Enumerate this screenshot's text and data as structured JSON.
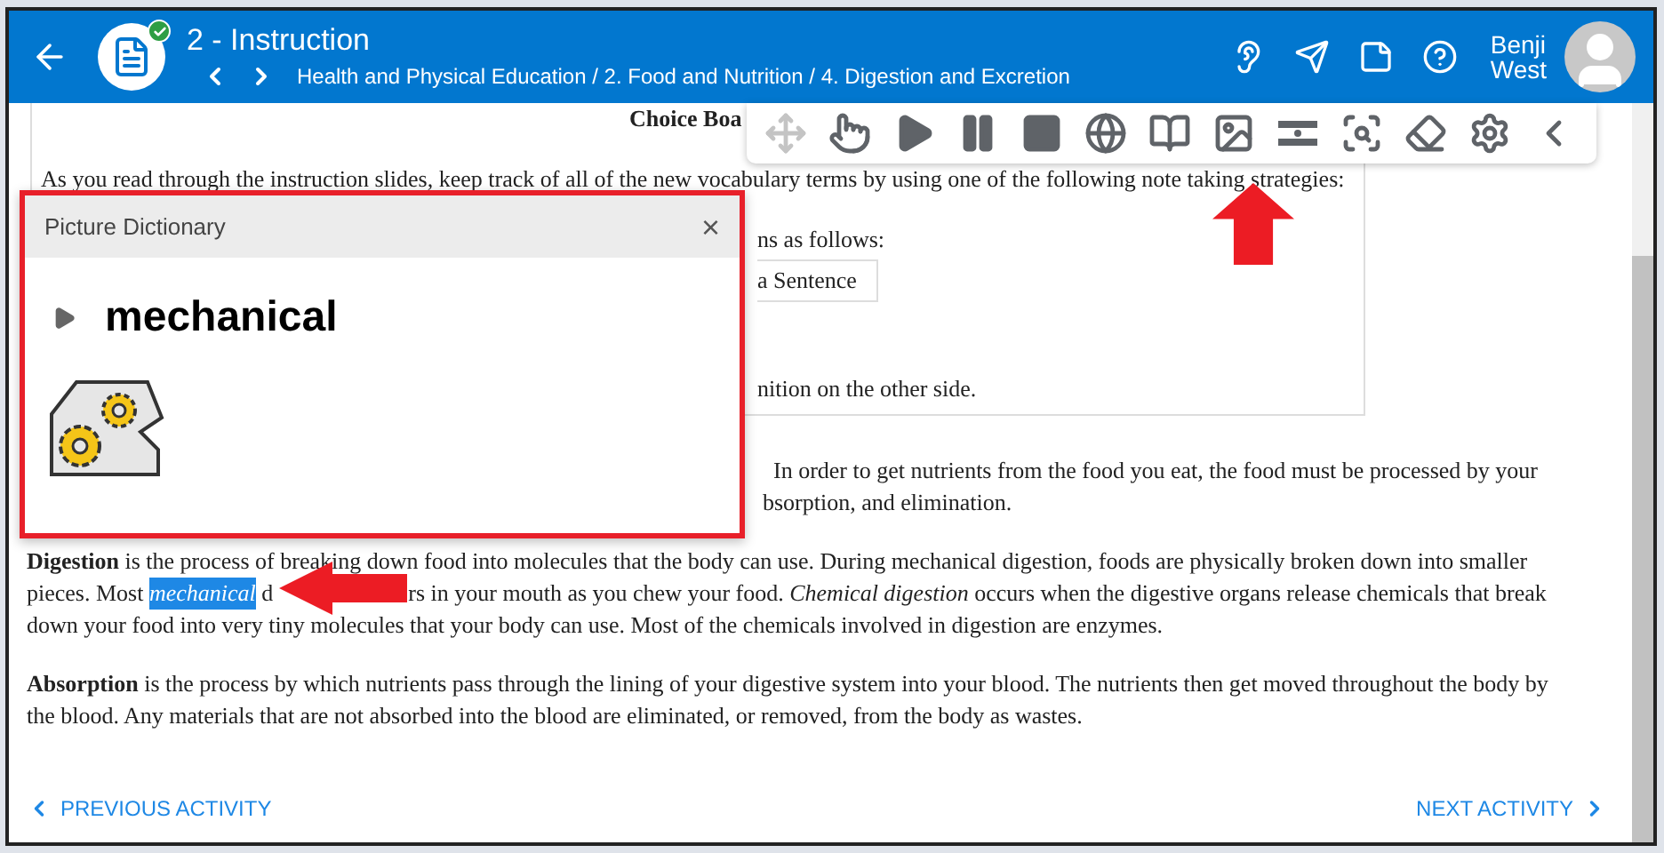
{
  "header": {
    "title": "2 - Instruction",
    "completed": true,
    "breadcrumb": "Health and Physical Education / 2. Food and Nutrition / 4. Digestion and Excretion",
    "user_first": "Benji",
    "user_last": "West"
  },
  "toolbar": {
    "tools": [
      {
        "kind": "move",
        "disabled": true
      },
      {
        "kind": "pointer",
        "disabled": false
      },
      {
        "kind": "play",
        "disabled": false
      },
      {
        "kind": "pause",
        "disabled": false
      },
      {
        "kind": "stop",
        "disabled": false
      },
      {
        "kind": "globe",
        "disabled": false
      },
      {
        "kind": "book",
        "disabled": false
      },
      {
        "kind": "picture",
        "disabled": false
      },
      {
        "kind": "mask",
        "disabled": false
      },
      {
        "kind": "magnifier",
        "disabled": false
      },
      {
        "kind": "eraser",
        "disabled": false
      },
      {
        "kind": "settings",
        "disabled": false
      },
      {
        "kind": "collapse",
        "disabled": false
      }
    ]
  },
  "content": {
    "heading_fragment": "Choice Boa",
    "intro": "As you read through the instruction slides, keep track of all of the new vocabulary terms by using one of the following note taking strategies:",
    "box_fragments": [
      "ns as follows:",
      "a Sentence",
      "nition on the other side."
    ],
    "partial_paragraph": [
      "In order to get nutrients from the food you eat, the food must be processed by your",
      "bsorption, and elimination."
    ],
    "digestion": {
      "line_1": "**Digestion** is the process of breaking down food into molecules that the body can use. During mechanical digestion, foods are physically broken down into smaller",
      "line_2_start": "pieces. Most ",
      "highlight": "mechanical",
      "line_2_fragment": " d",
      "line_2_end": "rs in your mouth as you chew your food. *Chemical digestion* occurs when the digestive organs release chemicals that break",
      "line_3": "down your food into very tiny molecules that your body can use. Most of the chemicals involved in digestion are enzymes."
    },
    "absorption": "**Absorption** is the process by which nutrients pass through the lining of your digestive system into your blood. The nutrients then get moved throughout the body by the blood. Any materials that are not absorbed into the blood are eliminated, or removed, from the body as wastes."
  },
  "popup": {
    "title": "Picture Dictionary",
    "close": "×",
    "word": "mechanical",
    "expanded": false
  },
  "footer": {
    "previous": "PREVIOUS ACTIVITY",
    "next": "NEXT ACTIVITY"
  }
}
